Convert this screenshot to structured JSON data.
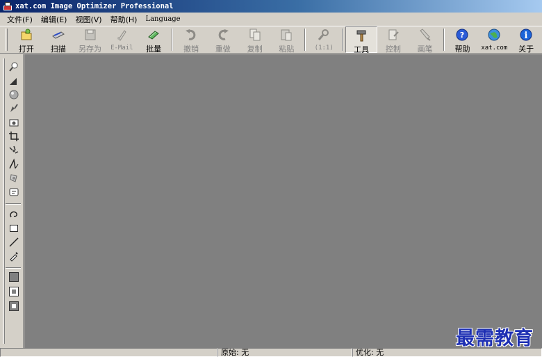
{
  "window": {
    "title": "xat.com  Image Optimizer Professional"
  },
  "menu": [
    "文件(F)",
    "编辑(E)",
    "视图(V)",
    "帮助(H)",
    "Language"
  ],
  "toolbar": [
    {
      "id": "open",
      "label": "打开",
      "icon": "open-folder-icon",
      "enabled": true
    },
    {
      "id": "scan",
      "label": "扫描",
      "icon": "scanner-icon",
      "enabled": true
    },
    {
      "id": "save-as",
      "label": "另存为",
      "icon": "save-icon",
      "enabled": false
    },
    {
      "id": "email",
      "label": "E-Mail",
      "icon": "email-icon",
      "enabled": false
    },
    {
      "id": "batch",
      "label": "批量",
      "icon": "batch-icon",
      "enabled": true
    },
    {
      "id": "undo",
      "label": "撤销",
      "icon": "undo-icon",
      "enabled": false
    },
    {
      "id": "redo",
      "label": "重做",
      "icon": "redo-icon",
      "enabled": false
    },
    {
      "id": "copy",
      "label": "复制",
      "icon": "copy-icon",
      "enabled": false
    },
    {
      "id": "paste",
      "label": "粘贴",
      "icon": "paste-icon",
      "enabled": false
    },
    {
      "id": "zoom-1-1",
      "label": "(1:1)",
      "icon": "zoom-icon",
      "enabled": false
    },
    {
      "id": "tools",
      "label": "工具",
      "icon": "tools-icon",
      "enabled": true,
      "pressed": true
    },
    {
      "id": "control",
      "label": "控制",
      "icon": "control-icon",
      "enabled": false
    },
    {
      "id": "brush",
      "label": "画笔",
      "icon": "brush-icon",
      "enabled": false
    },
    {
      "id": "help",
      "label": "帮助",
      "icon": "help-icon",
      "enabled": true
    },
    {
      "id": "xat",
      "label": "xat.com",
      "icon": "globe-icon",
      "enabled": true
    },
    {
      "id": "about",
      "label": "关于",
      "icon": "info-icon",
      "enabled": true
    }
  ],
  "tools": [
    "zoom-tool-icon",
    "triangle-tool-icon",
    "sphere-tool-icon",
    "pen-tool-icon",
    "camera-tool-icon",
    "crop-tool-icon",
    "transform-tool-icon",
    "text-tool-icon",
    "effect-tool-icon",
    "stamp-tool-icon",
    "lasso-tool-icon",
    "rectangle-tool-icon",
    "line-tool-icon",
    "eyedropper-tool-icon",
    "fill-color-icon",
    "inner-square-icon",
    "frame-square-icon"
  ],
  "status": {
    "original": "原始: 无",
    "optimized": "优化: 无"
  },
  "watermark": "最需教育",
  "colors": {
    "canvas": "#808080",
    "face": "#d4d0c8",
    "title_start": "#0a246a",
    "watermark": "#1d2fb3"
  }
}
